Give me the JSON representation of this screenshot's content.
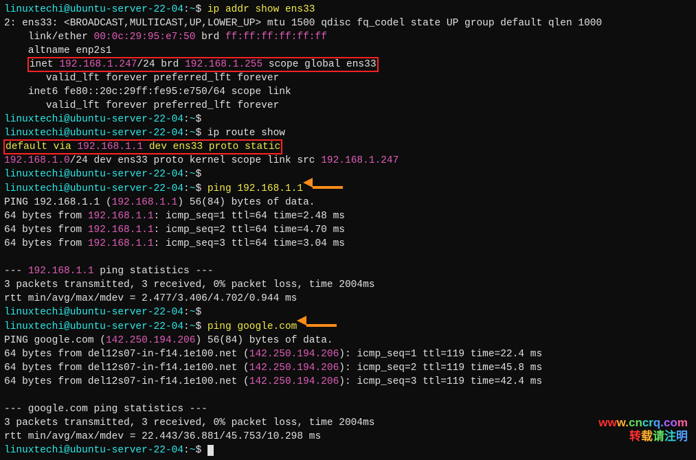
{
  "prompt": {
    "user": "linuxtechi",
    "host": "ubuntu-server-22-04",
    "cwd": "~",
    "suffix": "$ "
  },
  "commands": {
    "ip_addr": "ip addr show ens33",
    "ip_route": "ip route show",
    "ping_gw": "ping 192.168.1.1",
    "ping_google": "ping google.com"
  },
  "ip_addr": {
    "ifnum": "2",
    "ifname": "ens33",
    "flags": "<BROADCAST,MULTICAST,UP,LOWER_UP>",
    "mtu": "mtu 1500 qdisc fq_codel state UP group default qlen 1000",
    "mac": "00:0c:29:95:e7:50",
    "mac_brd": "ff:ff:ff:ff:ff:ff",
    "altname": "altname enp2s1",
    "inet_ip": "192.168.1.247",
    "inet_prefix": "/24 brd ",
    "inet_brd": "192.168.1.255",
    "inet_scope": " scope global ens33",
    "valid": "valid_lft forever preferred_lft forever",
    "inet6": "inet6 fe80::20c:29ff:fe95:e750/64 scope link"
  },
  "ip_route": {
    "default_pre": "default via ",
    "default_gw": "192.168.1.1",
    "default_post": " dev ens33 proto static",
    "route2_net": "192.168.1.0",
    "route2_mid": "/24 dev ens33 proto kernel scope link src ",
    "route2_src": "192.168.1.247"
  },
  "ping1": {
    "header_pre": "PING 192.168.1.1 (",
    "header_ip": "192.168.1.1",
    "header_post": ") 56(84) bytes of data.",
    "rows": [
      {
        "pre": "64 bytes from ",
        "ip": "192.168.1.1",
        "post": ": icmp_seq=1 ttl=64 time=2.48 ms"
      },
      {
        "pre": "64 bytes from ",
        "ip": "192.168.1.1",
        "post": ": icmp_seq=2 ttl=64 time=4.70 ms"
      },
      {
        "pre": "64 bytes from ",
        "ip": "192.168.1.1",
        "post": ": icmp_seq=3 ttl=64 time=3.04 ms"
      }
    ],
    "stats_title_ip": "192.168.1.1",
    "stats_title_rest": " ping statistics ---",
    "stats1": "3 packets transmitted, 3 received, 0% packet loss, time 2004ms",
    "stats2": "rtt min/avg/max/mdev = 2.477/3.406/4.702/0.944 ms"
  },
  "ping2": {
    "header_pre": "PING google.com (",
    "header_ip": "142.250.194.206",
    "header_post": ") 56(84) bytes of data.",
    "rows": [
      {
        "pre": "64 bytes from del12s07-in-f14.1e100.net (",
        "ip": "142.250.194.206",
        "post": "): icmp_seq=1 ttl=119 time=22.4 ms"
      },
      {
        "pre": "64 bytes from del12s07-in-f14.1e100.net (",
        "ip": "142.250.194.206",
        "post": "): icmp_seq=2 ttl=119 time=45.8 ms"
      },
      {
        "pre": "64 bytes from del12s07-in-f14.1e100.net (",
        "ip": "142.250.194.206",
        "post": "): icmp_seq=3 ttl=119 time=42.4 ms"
      }
    ],
    "stats_title": "--- google.com ping statistics ---",
    "stats1": "3 packets transmitted, 3 received, 0% packet loss, time 2004ms",
    "stats2": "rtt min/avg/max/mdev = 22.443/36.881/45.753/10.298 ms"
  },
  "watermark": {
    "url": "www.cncrq.com",
    "sub": "转载请注明"
  }
}
